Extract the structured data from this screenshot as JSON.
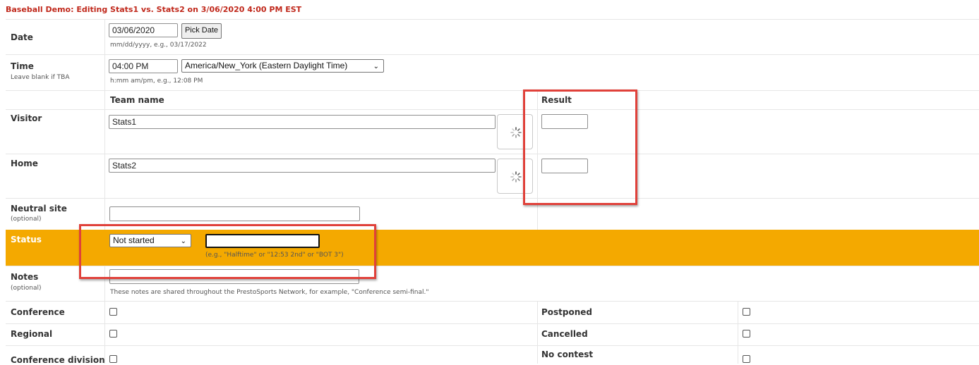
{
  "page_title": "Baseball Demo: Editing Stats1 vs. Stats2 on 3/06/2020 4:00 PM EST",
  "date": {
    "label": "Date",
    "value": "03/06/2020",
    "pick_button": "Pick Date",
    "hint": "mm/dd/yyyy, e.g., 03/17/2022"
  },
  "time": {
    "label": "Time",
    "sublabel": "Leave blank if TBA",
    "value": "04:00 PM",
    "timezone": "America/New_York (Eastern Daylight Time)",
    "hint": "h:mm am/pm, e.g., 12:08 PM"
  },
  "columns": {
    "team_name": "Team name",
    "result": "Result"
  },
  "visitor": {
    "label": "Visitor",
    "team": "Stats1",
    "result": ""
  },
  "home": {
    "label": "Home",
    "team": "Stats2",
    "result": ""
  },
  "neutral_site": {
    "label": "Neutral site",
    "sublabel": "(optional)",
    "value": ""
  },
  "status": {
    "label": "Status",
    "selected": "Not started",
    "text_value": "",
    "hint": "(e.g., \"Halftime\" or \"12:53 2nd\" or \"BOT 3\")"
  },
  "notes": {
    "label": "Notes",
    "sublabel": "(optional)",
    "value": "",
    "hint": "These notes are shared throughout the PrestoSports Network, for example, \"Conference semi-final.\""
  },
  "flags_left": [
    {
      "label": "Conference"
    },
    {
      "label": "Regional"
    },
    {
      "label": "Conference division"
    }
  ],
  "flags_right": [
    {
      "label": "Postponed"
    },
    {
      "label": "Cancelled"
    },
    {
      "label": "No contest"
    }
  ],
  "colors": {
    "title_red": "#c0281b",
    "status_band": "#f4a900",
    "highlight_box": "#e0413a"
  }
}
